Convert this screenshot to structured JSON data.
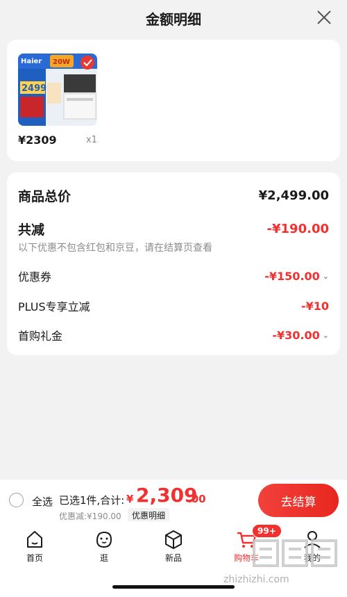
{
  "header": {
    "title": "金额明细"
  },
  "product": {
    "price": "¥2309",
    "qty": "x1"
  },
  "details": {
    "total_label": "商品总价",
    "total_value": "¥2,499.00",
    "reduce_label": "共减",
    "reduce_value": "-¥190.00",
    "note": "以下优惠不包含红包和京豆，请在结算页查看",
    "items": [
      {
        "label": "优惠券",
        "value": "-¥150.00",
        "expandable": true
      },
      {
        "label": "PLUS专享立减",
        "value": "-¥10",
        "expandable": false
      },
      {
        "label": "首购礼金",
        "value": "-¥30.00",
        "expandable": true
      }
    ]
  },
  "checkout": {
    "select_all": "全选",
    "selected_prefix": "已选1件,合计:",
    "currency": "¥",
    "total_integer": "2,309",
    "total_decimal": ".00",
    "discount_text": "优惠减:¥190.00",
    "detail_link": "优惠明细",
    "button": "去结算"
  },
  "tabs": [
    {
      "label": "首页",
      "icon": "home-icon"
    },
    {
      "label": "逛",
      "icon": "face-icon"
    },
    {
      "label": "新品",
      "icon": "box-icon"
    },
    {
      "label": "购物车",
      "icon": "cart-icon",
      "badge": "99+",
      "active": true
    },
    {
      "label": "我的",
      "icon": "user-icon"
    }
  ],
  "thumbnail_text": {
    "brand": "Haier",
    "price": "2499",
    "badge": "20W"
  },
  "watermark": "zhizhizhi.com",
  "colors": {
    "accent": "#f23030",
    "background": "#f2f2f2"
  }
}
